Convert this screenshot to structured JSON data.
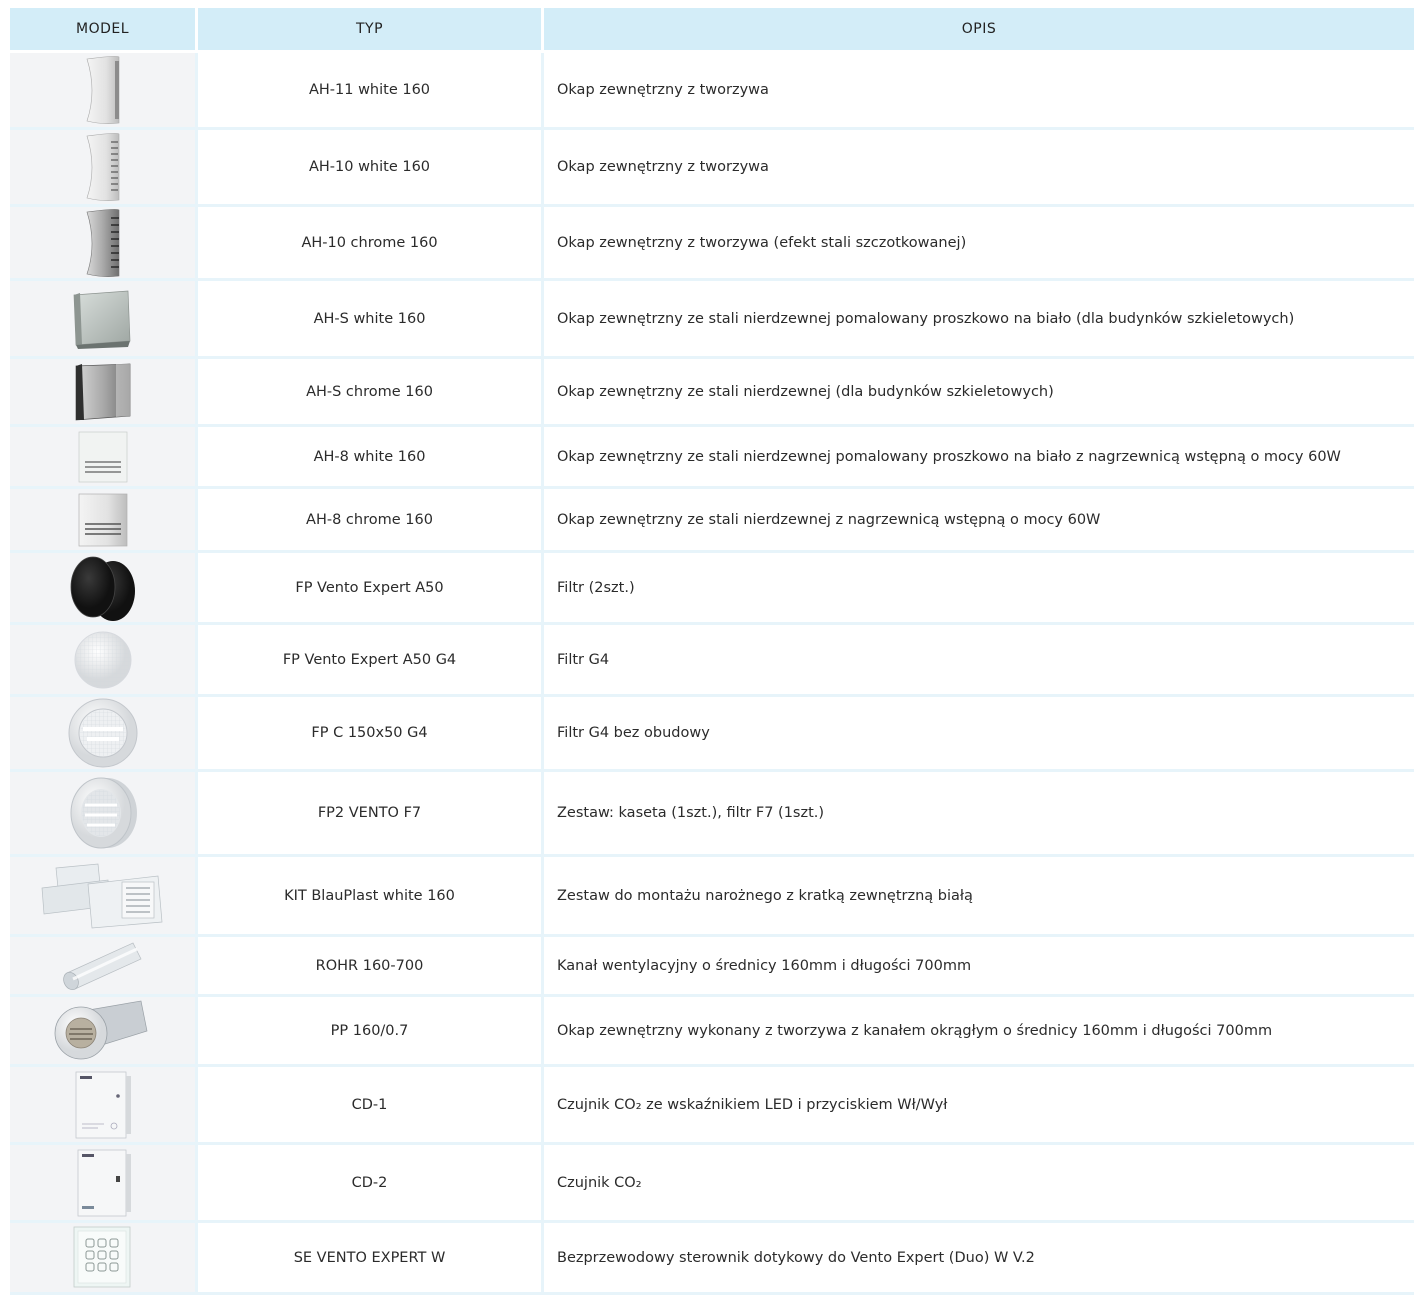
{
  "header": {
    "model": "MODEL",
    "typ": "TYP",
    "opis": "OPIS"
  },
  "rows": [
    {
      "typ": "AH-11 white 160",
      "opis": "Okap zewnętrzny z tworzywa",
      "icon": "white-plastic-hood-icon"
    },
    {
      "typ": "AH-10 white 160",
      "opis": "Okap zewnętrzny z tworzywa",
      "icon": "white-plastic-hood-grille-icon"
    },
    {
      "typ": "AH-10 chrome 160",
      "opis": "Okap zewnętrzny z tworzywa (efekt stali szczotkowanej)",
      "icon": "chrome-plastic-hood-icon"
    },
    {
      "typ": "AH-S white 160",
      "opis": "Okap zewnętrzny ze stali nierdzewnej pomalowany proszkowo na biało (dla budynków szkieletowych)",
      "icon": "white-steel-box-hood-icon"
    },
    {
      "typ": "AH-S chrome 160",
      "opis": "Okap zewnętrzny ze stali nierdzewnej  (dla budynków szkieletowych)",
      "icon": "chrome-steel-box-hood-icon"
    },
    {
      "typ": "AH-8 white 160",
      "opis": "Okap zewnętrzny ze stali nierdzewnej pomalowany proszkowo na biało z nagrzewnicą wstępną o mocy 60W",
      "icon": "white-heated-hood-icon"
    },
    {
      "typ": "AH-8 chrome 160",
      "opis": "Okap zewnętrzny ze stali nierdzewnej  z nagrzewnicą wstępną o mocy 60W",
      "icon": "chrome-heated-hood-icon"
    },
    {
      "typ": "FP Vento Expert A50",
      "opis": "Filtr (2szt.)",
      "icon": "black-filter-pads-icon"
    },
    {
      "typ": "FP Vento Expert A50 G4",
      "opis": "Filtr G4",
      "icon": "white-round-filter-icon"
    },
    {
      "typ": "FP C 150x50 G4",
      "opis": "Filtr G4 bez obudowy",
      "icon": "filter-cassette-icon"
    },
    {
      "typ": "FP2 VENTO F7",
      "opis": "Zestaw: kaseta (1szt.), filtr F7 (1szt.)",
      "icon": "filter-cassette-f7-icon"
    },
    {
      "typ": "KIT BlauPlast white 160",
      "opis": "Zestaw do montażu narożnego z kratką zewnętrzną białą",
      "icon": "duct-kit-icon"
    },
    {
      "typ": "ROHR 160-700",
      "opis": "Kanał wentylacyjny o średnicy 160mm i długości 700mm",
      "icon": "duct-pipe-icon"
    },
    {
      "typ": "PP 160/0.7",
      "opis": "Okap zewnętrzny wykonany z tworzywa z kanałem okrągłym o średnicy 160mm i długości 700mm",
      "icon": "hood-with-pipe-icon"
    },
    {
      "typ": "CD-1",
      "opis": "Czujnik CO₂ ze wskaźnikiem LED i przyciskiem Wł/Wył",
      "icon": "co2-sensor-led-icon"
    },
    {
      "typ": "CD-2",
      "opis": "Czujnik CO₂",
      "icon": "co2-sensor-icon"
    },
    {
      "typ": "SE VENTO EXPERT W",
      "opis": "Bezprzewodowy sterownik dotykowy do Vento Expert (Duo) W V.2",
      "icon": "touch-controller-icon"
    }
  ],
  "colors": {
    "header_bg": "#d3edf8",
    "row_line": "#e7f4fa",
    "model_cell_bg": "#f3f4f6"
  }
}
